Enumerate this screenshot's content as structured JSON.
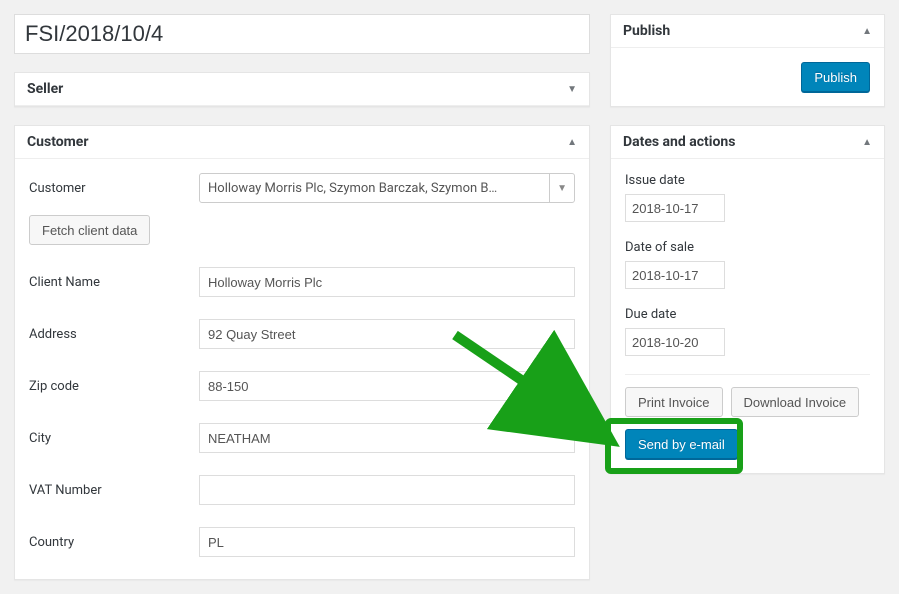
{
  "title": "FSI/2018/10/4",
  "seller": {
    "heading": "Seller"
  },
  "customer": {
    "heading": "Customer",
    "labels": {
      "customer": "Customer",
      "client_name": "Client Name",
      "address": "Address",
      "zip": "Zip code",
      "city": "City",
      "vat": "VAT Number",
      "country": "Country"
    },
    "select_value": "Holloway Morris Plc, Szymon Barczak, Szymon B…",
    "fetch_button": "Fetch client data",
    "values": {
      "client_name": "Holloway Morris Plc",
      "address": "92 Quay Street",
      "zip": "88-150",
      "city": "NEATHAM",
      "vat": "",
      "country": "PL"
    }
  },
  "publish": {
    "heading": "Publish",
    "button": "Publish"
  },
  "dates": {
    "heading": "Dates and actions",
    "issue_label": "Issue date",
    "issue": "2018-10-17",
    "sale_label": "Date of sale",
    "sale": "2018-10-17",
    "due_label": "Due date",
    "due": "2018-10-20",
    "print": "Print Invoice",
    "download": "Download Invoice",
    "send": "Send by e-mail"
  }
}
